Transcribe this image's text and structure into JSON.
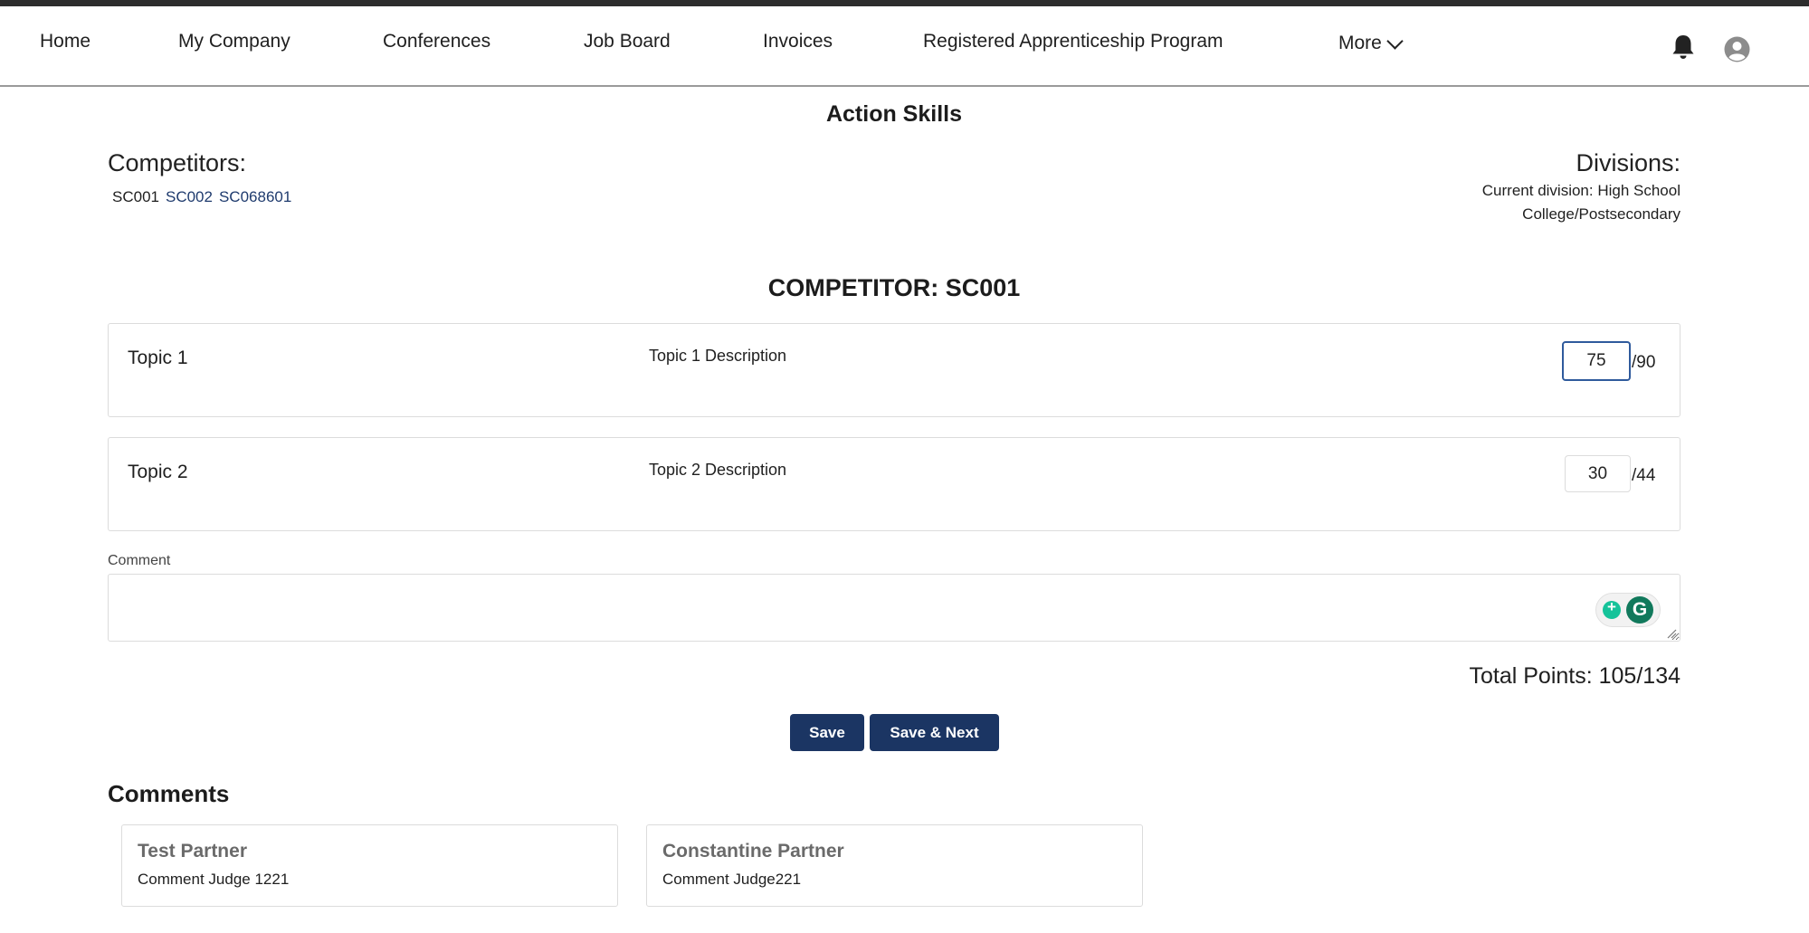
{
  "nav": {
    "items": [
      "Home",
      "My Company",
      "Conferences",
      "Job Board",
      "Invoices",
      "Registered Apprenticeship Program"
    ],
    "more_label": "More",
    "icons": {
      "notifications": "bell-icon",
      "profile": "user-avatar-icon",
      "more": "chevron-down-icon"
    }
  },
  "page": {
    "title": "Action Skills"
  },
  "competitors": {
    "heading": "Competitors:",
    "current": "SC001",
    "others": [
      "SC002",
      "SC068601"
    ]
  },
  "divisions": {
    "heading": "Divisions:",
    "current": "Current division: High School",
    "other": "College/Postsecondary"
  },
  "competitor_title": "COMPETITOR: SC001",
  "topics": [
    {
      "name": "Topic 1",
      "description": "Topic 1 Description",
      "score": "75",
      "max": "/90"
    },
    {
      "name": "Topic 2",
      "description": "Topic 2 Description",
      "score": "30",
      "max": "/44"
    }
  ],
  "comment": {
    "label": "Comment",
    "value": ""
  },
  "total_points": "Total Points: 105/134",
  "buttons": {
    "save": "Save",
    "save_next": "Save & Next"
  },
  "comments": {
    "heading": "Comments",
    "items": [
      {
        "author": "Test Partner",
        "text": "Comment Judge 1221"
      },
      {
        "author": "Constantine Partner",
        "text": "Comment Judge221"
      }
    ]
  },
  "colors": {
    "primary_button": "#1b3563",
    "link": "#1f3b6e",
    "focus_border": "#2f5a9c",
    "grammarly_green": "#15c39a"
  }
}
